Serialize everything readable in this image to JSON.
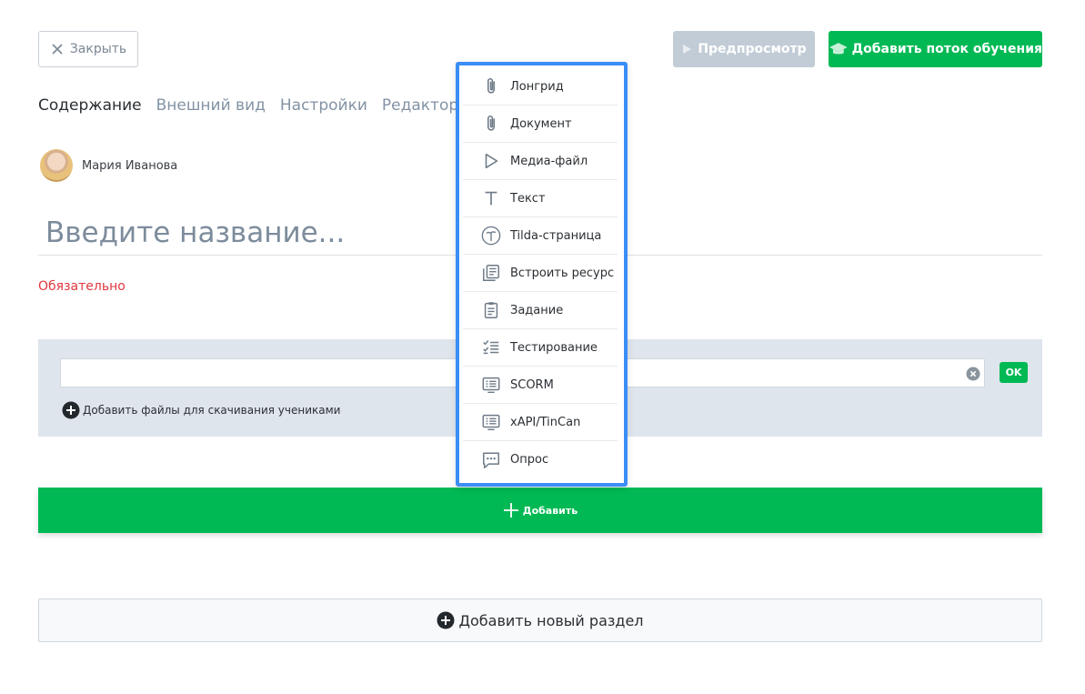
{
  "header": {
    "close_label": "Закрыть",
    "preview_label": "Предпросмотр",
    "add_stream_label": "Добавить поток обучения"
  },
  "tabs": [
    {
      "label": "Содержание",
      "active": true
    },
    {
      "label": "Внешний вид",
      "active": false
    },
    {
      "label": "Настройки",
      "active": false
    },
    {
      "label": "Редакторы",
      "active": false
    }
  ],
  "author": {
    "name": "Мария Иванова"
  },
  "title": {
    "placeholder": "Введите название...",
    "required_text": "Обязательно"
  },
  "lesson": {
    "ok_label": "OK",
    "add_files_label": "Добавить файлы для скачивания учениками",
    "add_label": "Добавить"
  },
  "add_section_label": "Добавить новый раздел",
  "menu": {
    "items": [
      {
        "label": "Лонгрид",
        "icon": "paperclip-icon"
      },
      {
        "label": "Документ",
        "icon": "paperclip-icon"
      },
      {
        "label": "Медиа-файл",
        "icon": "play-icon"
      },
      {
        "label": "Текст",
        "icon": "text-icon"
      },
      {
        "label": "Tilda-страница",
        "icon": "tilda-icon"
      },
      {
        "label": "Встроить ресурс",
        "icon": "embed-icon"
      },
      {
        "label": "Задание",
        "icon": "clipboard-icon"
      },
      {
        "label": "Тестирование",
        "icon": "checklist-icon"
      },
      {
        "label": "SCORM",
        "icon": "package-icon"
      },
      {
        "label": "xAPI/TinCan",
        "icon": "package-icon"
      },
      {
        "label": "Опрос",
        "icon": "comment-icon"
      }
    ]
  },
  "colors": {
    "accent_green": "#00b954",
    "menu_border": "#3b8ef5",
    "required_red": "#e0383e",
    "muted_text": "#8393a4"
  }
}
